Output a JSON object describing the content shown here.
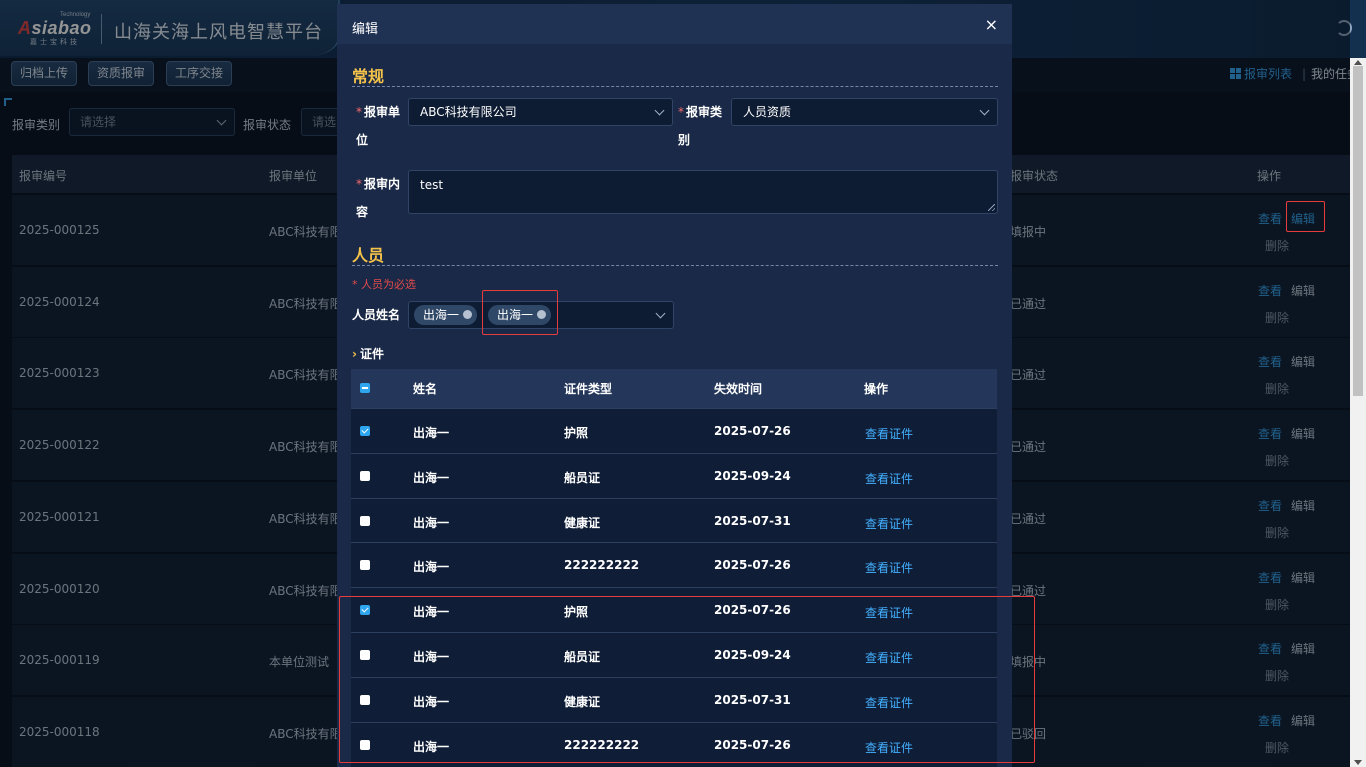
{
  "app": {
    "logo_text_a": "A",
    "logo_text_rest": "siabao",
    "logo_tech": "Technology",
    "logo_sub": "嘉士宝科技",
    "title": "山海关海上风电智慧平台"
  },
  "toolbar": {
    "buttons": [
      "归档上传",
      "资质报审",
      "工序交接"
    ],
    "report_list": "报审列表",
    "my_tasks": "我的任务"
  },
  "filters": {
    "type_label": "报审类别",
    "type_placeholder": "请选择",
    "status_label": "报审状态",
    "status_placeholder": "请选"
  },
  "bg_table": {
    "columns": [
      "报审编号",
      "报审单位",
      "报审状态",
      "操作"
    ],
    "rows": [
      {
        "id": "2025-000125",
        "unit": "ABC科技有限",
        "status": "填报中"
      },
      {
        "id": "2025-000124",
        "unit": "ABC科技有限",
        "status": "已通过"
      },
      {
        "id": "2025-000123",
        "unit": "ABC科技有限",
        "status": "已通过"
      },
      {
        "id": "2025-000122",
        "unit": "ABC科技有限",
        "status": "已通过"
      },
      {
        "id": "2025-000121",
        "unit": "ABC科技有限",
        "status": "已通过"
      },
      {
        "id": "2025-000120",
        "unit": "ABC科技有限",
        "status": "已通过"
      },
      {
        "id": "2025-000119",
        "unit": "本单位测试",
        "status": "填报中"
      },
      {
        "id": "2025-000118",
        "unit": "ABC科技有限",
        "status": "已驳回"
      }
    ],
    "actions": {
      "view": "查看",
      "edit": "编辑",
      "delete": "删除"
    }
  },
  "modal": {
    "title": "编辑",
    "close": "×",
    "section_general": "常规",
    "unit_label": "报审单位",
    "unit_value": "ABC科技有限公司",
    "category_label": "报审类别",
    "category_value": "人员资质",
    "content_label": "报审内容",
    "content_value": "test",
    "section_people": "人员",
    "people_required_hint": "* 人员为必选",
    "person_name_label": "人员姓名",
    "person_tags": [
      "出海一",
      "出海一"
    ],
    "cert_title": "证件",
    "cert_columns": [
      "姓名",
      "证件类型",
      "失效时间",
      "操作"
    ],
    "cert_rows": [
      {
        "checked": true,
        "name": "出海一",
        "type": "护照",
        "expires": "2025-07-26",
        "action": "查看证件"
      },
      {
        "checked": false,
        "name": "出海一",
        "type": "船员证",
        "expires": "2025-09-24",
        "action": "查看证件"
      },
      {
        "checked": false,
        "name": "出海一",
        "type": "健康证",
        "expires": "2025-07-31",
        "action": "查看证件"
      },
      {
        "checked": false,
        "name": "出海一",
        "type": "222222222",
        "expires": "2025-07-26",
        "action": "查看证件"
      },
      {
        "checked": true,
        "name": "出海一",
        "type": "护照",
        "expires": "2025-07-26",
        "action": "查看证件"
      },
      {
        "checked": false,
        "name": "出海一",
        "type": "船员证",
        "expires": "2025-09-24",
        "action": "查看证件"
      },
      {
        "checked": false,
        "name": "出海一",
        "type": "健康证",
        "expires": "2025-07-31",
        "action": "查看证件"
      },
      {
        "checked": false,
        "name": "出海一",
        "type": "222222222",
        "expires": "2025-07-26",
        "action": "查看证件"
      }
    ]
  },
  "colors": {
    "accent_blue": "#3aa5ee",
    "section_gold": "#f4c24a",
    "highlight_red": "#e63c3c"
  }
}
